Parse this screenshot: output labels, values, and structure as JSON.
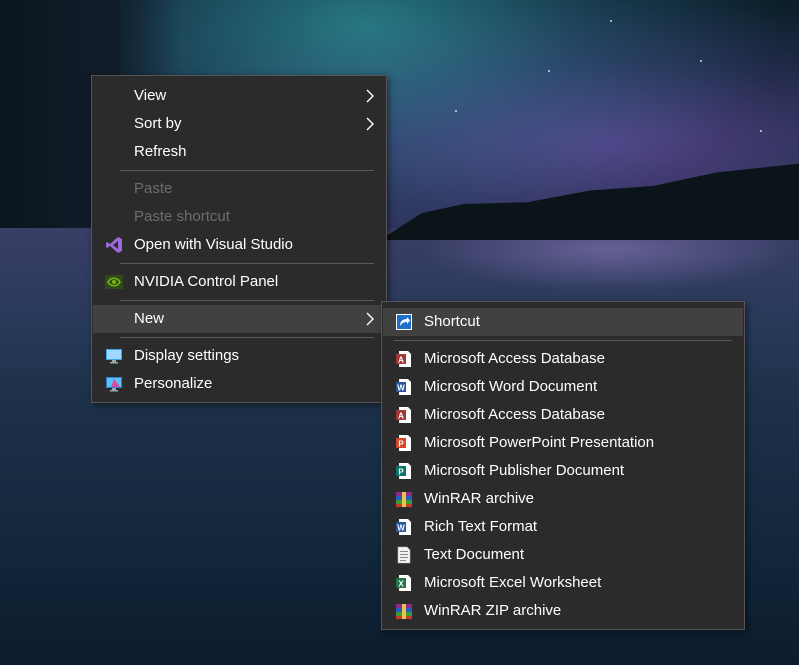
{
  "desktop": {
    "wallpaper": "night-lake-aurora"
  },
  "context_menu": {
    "items": [
      {
        "label": "View",
        "has_submenu": true
      },
      {
        "label": "Sort by",
        "has_submenu": true
      },
      {
        "label": "Refresh"
      },
      {
        "label": "Paste",
        "disabled": true
      },
      {
        "label": "Paste shortcut",
        "disabled": true
      },
      {
        "label": "Open with Visual Studio",
        "icon": "visual-studio-icon"
      },
      {
        "label": "NVIDIA Control Panel",
        "icon": "nvidia-icon"
      },
      {
        "label": "New",
        "has_submenu": true,
        "highlighted": true
      },
      {
        "label": "Display settings",
        "icon": "display-settings-icon"
      },
      {
        "label": "Personalize",
        "icon": "personalize-icon"
      }
    ]
  },
  "new_submenu": {
    "items": [
      {
        "label": "Shortcut",
        "icon": "shortcut-icon",
        "highlighted": true
      },
      {
        "label": "Microsoft Access Database",
        "icon": "access-icon"
      },
      {
        "label": "Microsoft Word Document",
        "icon": "word-icon"
      },
      {
        "label": "Microsoft Access Database",
        "icon": "access-icon"
      },
      {
        "label": "Microsoft PowerPoint Presentation",
        "icon": "powerpoint-icon"
      },
      {
        "label": "Microsoft Publisher Document",
        "icon": "publisher-icon"
      },
      {
        "label": "WinRAR archive",
        "icon": "winrar-icon"
      },
      {
        "label": "Rich Text Format",
        "icon": "rtf-icon"
      },
      {
        "label": "Text Document",
        "icon": "text-document-icon"
      },
      {
        "label": "Microsoft Excel Worksheet",
        "icon": "excel-icon"
      },
      {
        "label": "WinRAR ZIP archive",
        "icon": "winrar-zip-icon"
      }
    ]
  },
  "colors": {
    "menu_bg": "#2b2b2b",
    "menu_highlight": "#414141",
    "text": "#ffffff",
    "disabled_text": "#6d6d6d"
  }
}
